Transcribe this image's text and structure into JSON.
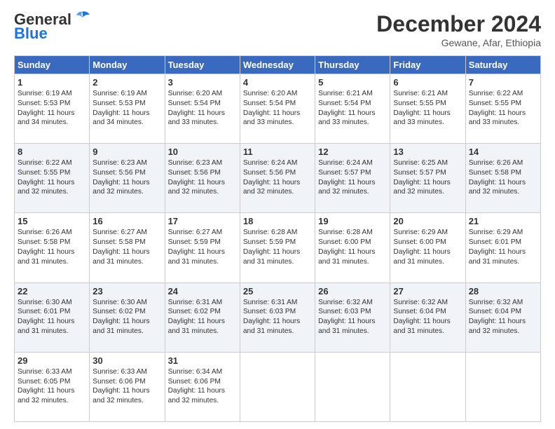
{
  "logo": {
    "text_general": "General",
    "text_blue": "Blue"
  },
  "header": {
    "month": "December 2024",
    "location": "Gewane, Afar, Ethiopia"
  },
  "weekdays": [
    "Sunday",
    "Monday",
    "Tuesday",
    "Wednesday",
    "Thursday",
    "Friday",
    "Saturday"
  ],
  "weeks": [
    [
      {
        "day": "1",
        "sunrise": "6:19 AM",
        "sunset": "5:53 PM",
        "daylight": "11 hours and 34 minutes."
      },
      {
        "day": "2",
        "sunrise": "6:19 AM",
        "sunset": "5:53 PM",
        "daylight": "11 hours and 34 minutes."
      },
      {
        "day": "3",
        "sunrise": "6:20 AM",
        "sunset": "5:54 PM",
        "daylight": "11 hours and 33 minutes."
      },
      {
        "day": "4",
        "sunrise": "6:20 AM",
        "sunset": "5:54 PM",
        "daylight": "11 hours and 33 minutes."
      },
      {
        "day": "5",
        "sunrise": "6:21 AM",
        "sunset": "5:54 PM",
        "daylight": "11 hours and 33 minutes."
      },
      {
        "day": "6",
        "sunrise": "6:21 AM",
        "sunset": "5:55 PM",
        "daylight": "11 hours and 33 minutes."
      },
      {
        "day": "7",
        "sunrise": "6:22 AM",
        "sunset": "5:55 PM",
        "daylight": "11 hours and 33 minutes."
      }
    ],
    [
      {
        "day": "8",
        "sunrise": "6:22 AM",
        "sunset": "5:55 PM",
        "daylight": "11 hours and 32 minutes."
      },
      {
        "day": "9",
        "sunrise": "6:23 AM",
        "sunset": "5:56 PM",
        "daylight": "11 hours and 32 minutes."
      },
      {
        "day": "10",
        "sunrise": "6:23 AM",
        "sunset": "5:56 PM",
        "daylight": "11 hours and 32 minutes."
      },
      {
        "day": "11",
        "sunrise": "6:24 AM",
        "sunset": "5:56 PM",
        "daylight": "11 hours and 32 minutes."
      },
      {
        "day": "12",
        "sunrise": "6:24 AM",
        "sunset": "5:57 PM",
        "daylight": "11 hours and 32 minutes."
      },
      {
        "day": "13",
        "sunrise": "6:25 AM",
        "sunset": "5:57 PM",
        "daylight": "11 hours and 32 minutes."
      },
      {
        "day": "14",
        "sunrise": "6:26 AM",
        "sunset": "5:58 PM",
        "daylight": "11 hours and 32 minutes."
      }
    ],
    [
      {
        "day": "15",
        "sunrise": "6:26 AM",
        "sunset": "5:58 PM",
        "daylight": "11 hours and 31 minutes."
      },
      {
        "day": "16",
        "sunrise": "6:27 AM",
        "sunset": "5:58 PM",
        "daylight": "11 hours and 31 minutes."
      },
      {
        "day": "17",
        "sunrise": "6:27 AM",
        "sunset": "5:59 PM",
        "daylight": "11 hours and 31 minutes."
      },
      {
        "day": "18",
        "sunrise": "6:28 AM",
        "sunset": "5:59 PM",
        "daylight": "11 hours and 31 minutes."
      },
      {
        "day": "19",
        "sunrise": "6:28 AM",
        "sunset": "6:00 PM",
        "daylight": "11 hours and 31 minutes."
      },
      {
        "day": "20",
        "sunrise": "6:29 AM",
        "sunset": "6:00 PM",
        "daylight": "11 hours and 31 minutes."
      },
      {
        "day": "21",
        "sunrise": "6:29 AM",
        "sunset": "6:01 PM",
        "daylight": "11 hours and 31 minutes."
      }
    ],
    [
      {
        "day": "22",
        "sunrise": "6:30 AM",
        "sunset": "6:01 PM",
        "daylight": "11 hours and 31 minutes."
      },
      {
        "day": "23",
        "sunrise": "6:30 AM",
        "sunset": "6:02 PM",
        "daylight": "11 hours and 31 minutes."
      },
      {
        "day": "24",
        "sunrise": "6:31 AM",
        "sunset": "6:02 PM",
        "daylight": "11 hours and 31 minutes."
      },
      {
        "day": "25",
        "sunrise": "6:31 AM",
        "sunset": "6:03 PM",
        "daylight": "11 hours and 31 minutes."
      },
      {
        "day": "26",
        "sunrise": "6:32 AM",
        "sunset": "6:03 PM",
        "daylight": "11 hours and 31 minutes."
      },
      {
        "day": "27",
        "sunrise": "6:32 AM",
        "sunset": "6:04 PM",
        "daylight": "11 hours and 31 minutes."
      },
      {
        "day": "28",
        "sunrise": "6:32 AM",
        "sunset": "6:04 PM",
        "daylight": "11 hours and 32 minutes."
      }
    ],
    [
      {
        "day": "29",
        "sunrise": "6:33 AM",
        "sunset": "6:05 PM",
        "daylight": "11 hours and 32 minutes."
      },
      {
        "day": "30",
        "sunrise": "6:33 AM",
        "sunset": "6:06 PM",
        "daylight": "11 hours and 32 minutes."
      },
      {
        "day": "31",
        "sunrise": "6:34 AM",
        "sunset": "6:06 PM",
        "daylight": "11 hours and 32 minutes."
      },
      null,
      null,
      null,
      null
    ]
  ]
}
